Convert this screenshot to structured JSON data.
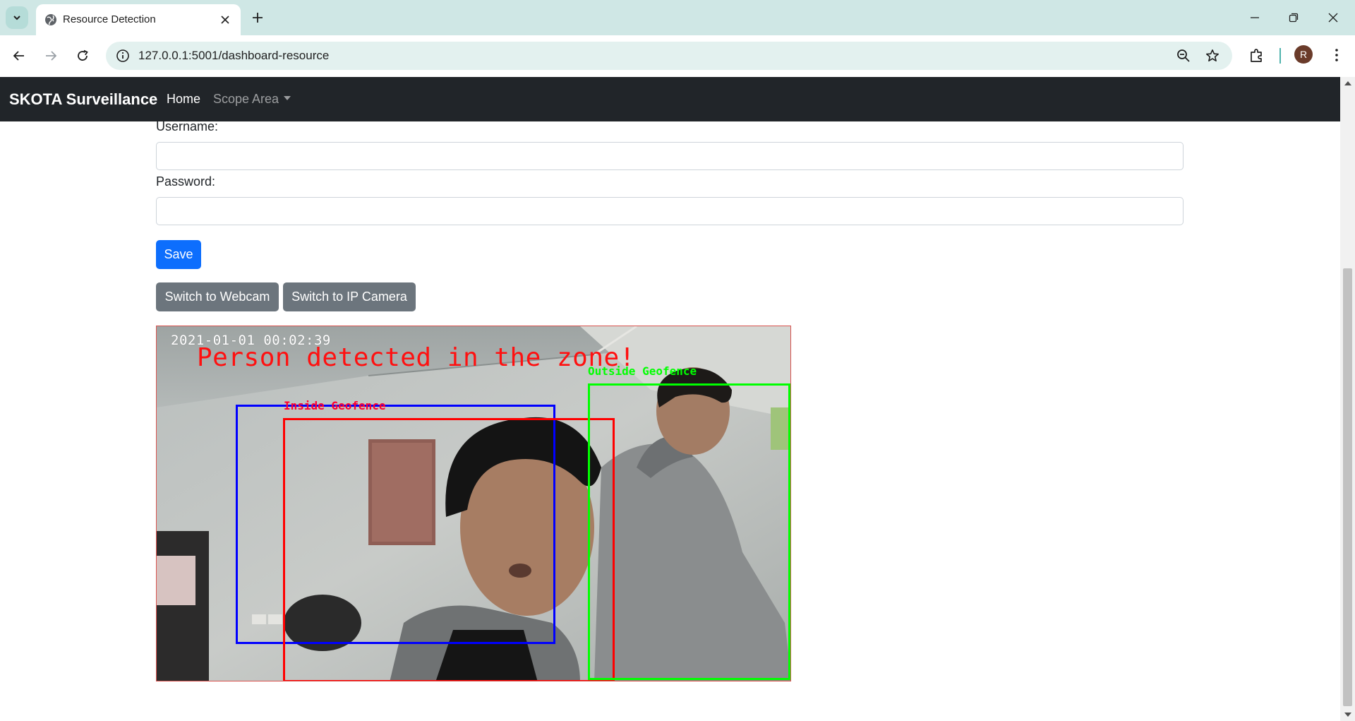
{
  "browser": {
    "tab_title": "Resource Detection",
    "url": "127.0.0.1:5001/dashboard-resource",
    "profile_initial": "R"
  },
  "navbar": {
    "brand": "SKOTA Surveillance",
    "home": "Home",
    "scope_area": "Scope Area"
  },
  "form": {
    "username_label": "Username:",
    "username_value": "",
    "password_label": "Password:",
    "password_value": "",
    "save_label": "Save"
  },
  "camera_buttons": {
    "webcam": "Switch to Webcam",
    "ip_camera": "Switch to IP Camera"
  },
  "feed": {
    "timestamp": "2021-01-01 00:02:39",
    "alert": "Person detected in the zone!",
    "inside_label": "Inside Geofence",
    "outside_label": "Outside Geofence"
  },
  "colors": {
    "navbar_bg": "#212529",
    "primary": "#0d6efd",
    "secondary": "#6c757d",
    "inside_zone": "#ff0000",
    "outside_zone": "#00ff00",
    "geofence": "#0000ff"
  }
}
